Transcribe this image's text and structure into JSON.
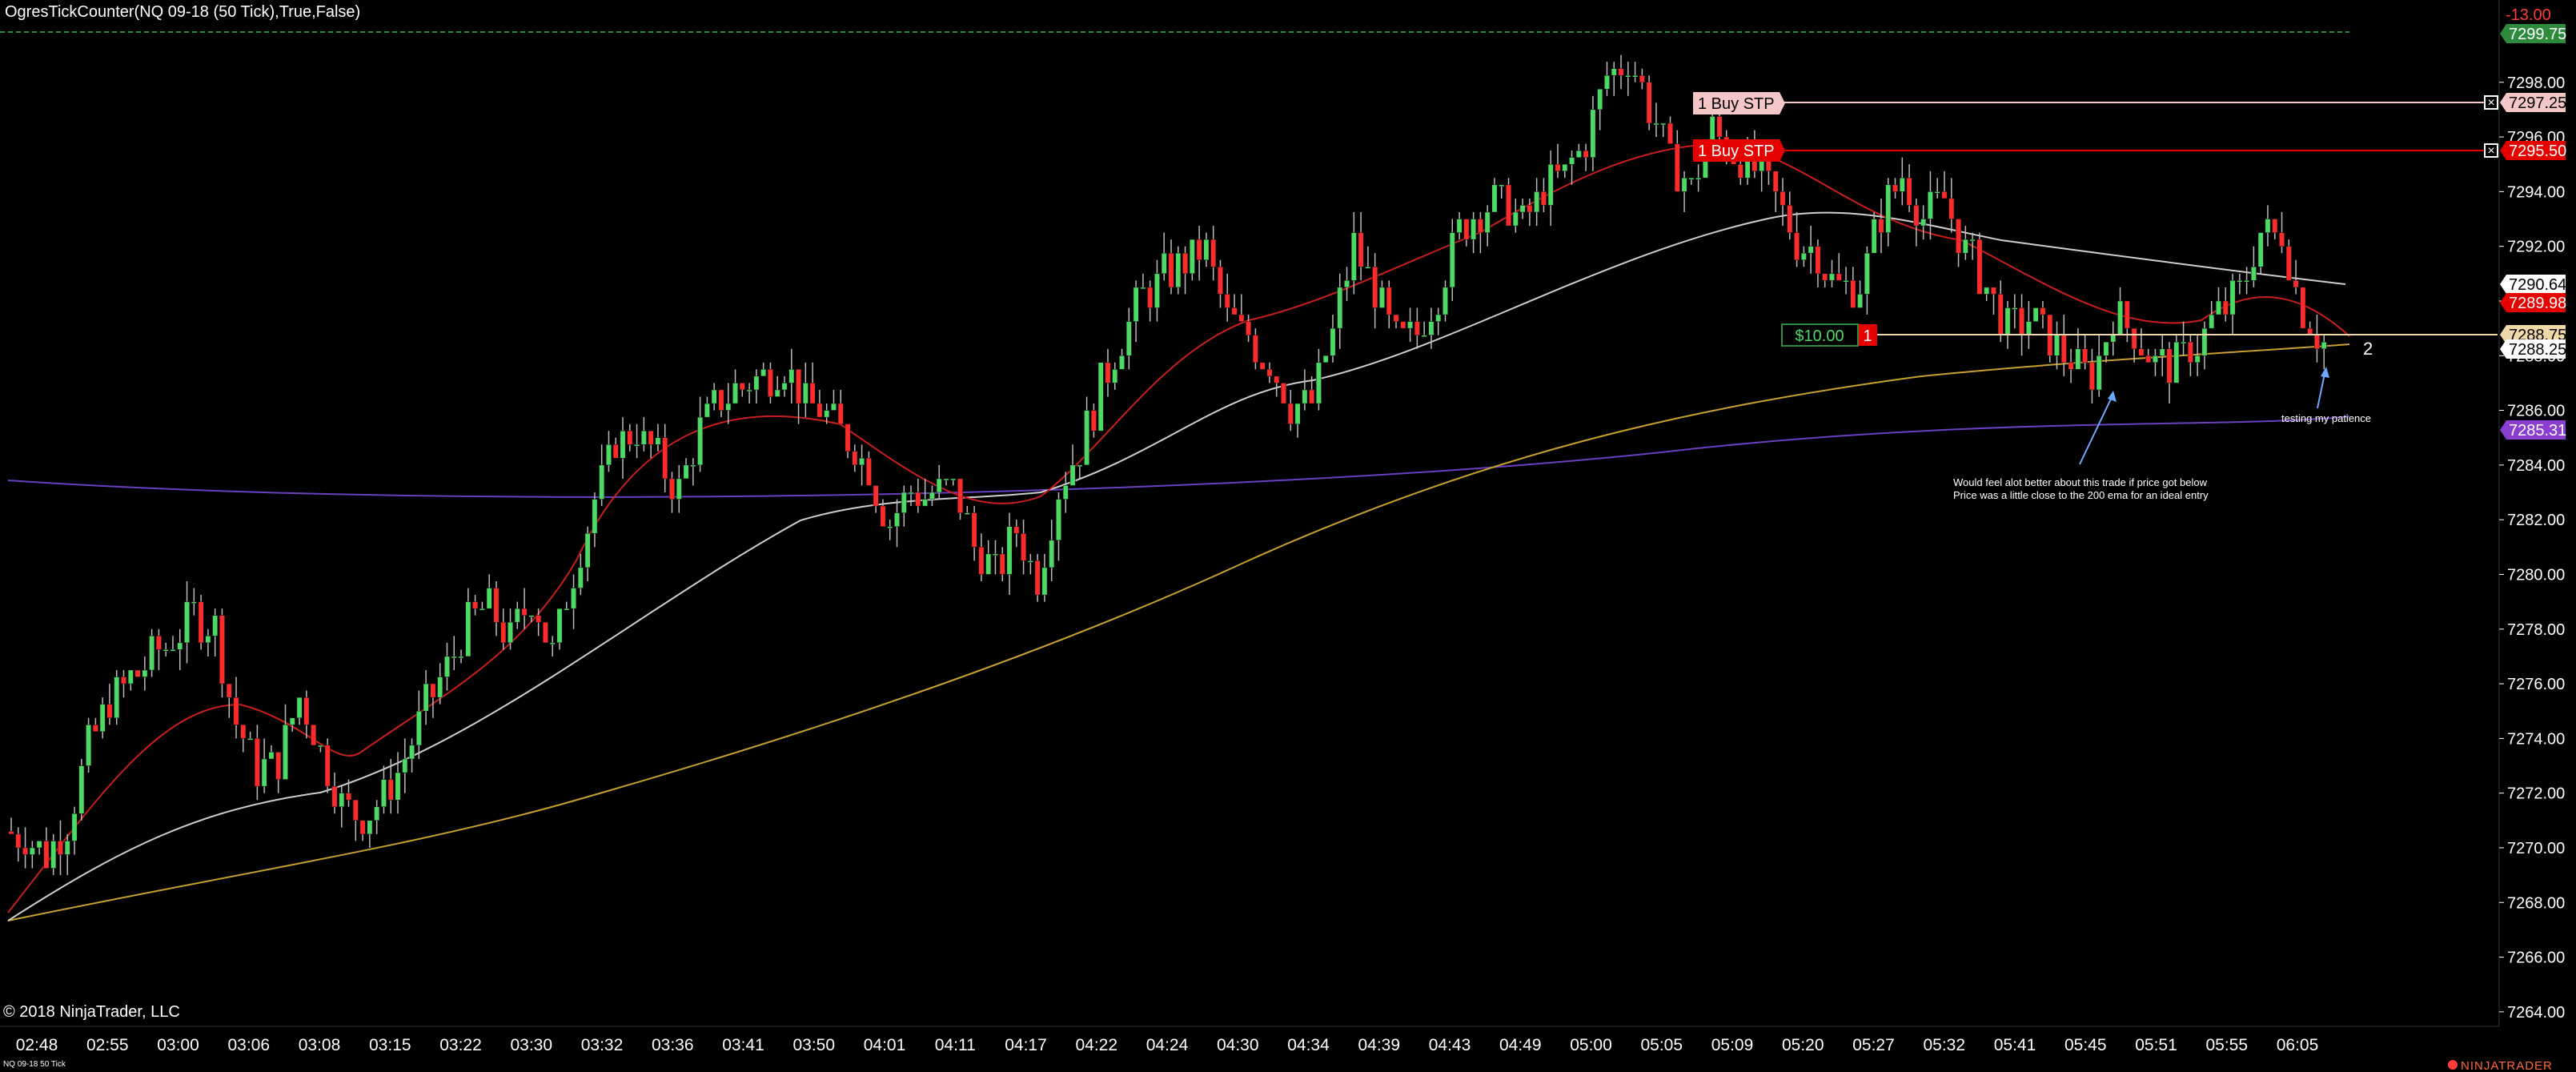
{
  "header": {
    "indicator_title": "OgresTickCounter(NQ 09-18 (50 Tick),True,False)",
    "tick_counter_value": "-13.00"
  },
  "footer": {
    "copyright": "© 2018 NinjaTrader, LLC",
    "instrument_caption": "NQ 09-18 50 Tick",
    "brand": "NINJATRADER"
  },
  "price_axis": {
    "labels": [
      "7264.00",
      "7266.00",
      "7268.00",
      "7270.00",
      "7272.00",
      "7274.00",
      "7276.00",
      "7278.00",
      "7280.00",
      "7282.00",
      "7284.00",
      "7286.00",
      "7288.00",
      "7290.00",
      "7292.00",
      "7294.00",
      "7296.00",
      "7298.00"
    ],
    "markers": [
      {
        "value": "7299.75",
        "color": "#2e8b3e",
        "text_color": "#ffffff"
      },
      {
        "value": "7297.25",
        "color": "#f5c6c6",
        "text_color": "#000000"
      },
      {
        "value": "7295.50",
        "color": "#e60000",
        "text_color": "#ffffff"
      },
      {
        "value": "7290.64",
        "color": "#ffffff",
        "text_color": "#000000"
      },
      {
        "value": "7289.98",
        "color": "#e60000",
        "text_color": "#ffffff"
      },
      {
        "value": "7288.75",
        "color": "#f0d8a8",
        "text_color": "#000000"
      },
      {
        "value": "7288.25",
        "color": "#ffffff",
        "text_color": "#000000"
      },
      {
        "value": "7285.31",
        "color": "#8a3fd1",
        "text_color": "#ffffff"
      }
    ]
  },
  "time_axis": {
    "labels": [
      "02:48",
      "02:55",
      "03:00",
      "03:06",
      "03:08",
      "03:15",
      "03:22",
      "03:30",
      "03:32",
      "03:36",
      "03:41",
      "03:50",
      "04:01",
      "04:11",
      "04:17",
      "04:22",
      "04:24",
      "04:30",
      "04:34",
      "04:39",
      "04:43",
      "04:49",
      "05:00",
      "05:05",
      "05:09",
      "05:20",
      "05:27",
      "05:32",
      "05:41",
      "05:45",
      "05:51",
      "05:55",
      "06:05"
    ]
  },
  "orders": [
    {
      "label": "1 Buy STP",
      "price": "7297.25",
      "color": "#f5c6c6",
      "text_color": "#000000",
      "close_icon": "×"
    },
    {
      "label": "1 Buy STP",
      "price": "7295.50",
      "color": "#e60000",
      "text_color": "#ffffff",
      "close_icon": "×"
    }
  ],
  "position": {
    "pnl": "$10.00",
    "qty": "1",
    "price": "7288.75",
    "count_label": "2"
  },
  "annotations": {
    "note_1_line_1": "Would feel alot better about this trade if price got below",
    "note_1_line_2": "Price was a little close to the 200 ema for an ideal entry",
    "note_2": "testing my patience"
  },
  "colors": {
    "up_candle": "#4cd964",
    "down_candle": "#ff2a2a",
    "ema_fast": "#c81e1e",
    "ema_mid": "#cfcfcf",
    "ema_200": "#c8a030",
    "ema_long": "#6a3fc0",
    "annotation_arrow": "#6fa8ff"
  },
  "chart_data": {
    "type": "candlestick",
    "ylim": [
      7263.0,
      7300.5
    ],
    "price_path": [
      7270.6,
      7270.4,
      7269.7,
      7270.9,
      7273.6,
      7275.4,
      7276.2,
      7276.9,
      7277.6,
      7278.5,
      7278.0,
      7274.5,
      7272.8,
      7273.1,
      7275.6,
      7273.6,
      7271.6,
      7271.2,
      7271.8,
      7273.4,
      7275.1,
      7276.6,
      7278.3,
      7278.8,
      7277.6,
      7279.2,
      7277.2,
      7280.1,
      7282.7,
      7284.8,
      7285.2,
      7284.3,
      7283.0,
      7285.4,
      7286.5,
      7286.8,
      7287.3,
      7287.6,
      7286.2,
      7285.9,
      7285.0,
      7283.8,
      7281.8,
      7283.0,
      7282.9,
      7283.2,
      7281.1,
      7280.0,
      7281.6,
      7279.8,
      7283.2,
      7284.6,
      7286.9,
      7288.6,
      7290.2,
      7290.9,
      7291.5,
      7291.8,
      7289.3,
      7288.7,
      7287.7,
      7286.2,
      7286.3,
      7288.9,
      7292.0,
      7290.4,
      7288.5,
      7288.9,
      7290.3,
      7292.6,
      7293.4,
      7293.6,
      7292.9,
      7294.1,
      7294.7,
      7295.9,
      7298.2,
      7298.9,
      7297.1,
      7295.1,
      7294.2,
      7296.3,
      7295.5,
      7294.8,
      7293.8,
      7292.2,
      7291.7,
      7290.4,
      7290.6,
      7293.2,
      7294.6,
      7293.1,
      7293.8,
      7291.9,
      7290.5,
      7289.0,
      7289.3,
      7288.6,
      7287.8,
      7287.2,
      7289.5,
      7288.9,
      7287.6,
      7287.8,
      7288.4,
      7289.5,
      7290.3,
      7292.6,
      7292.4,
      7289.6,
      7288.5
    ]
  }
}
